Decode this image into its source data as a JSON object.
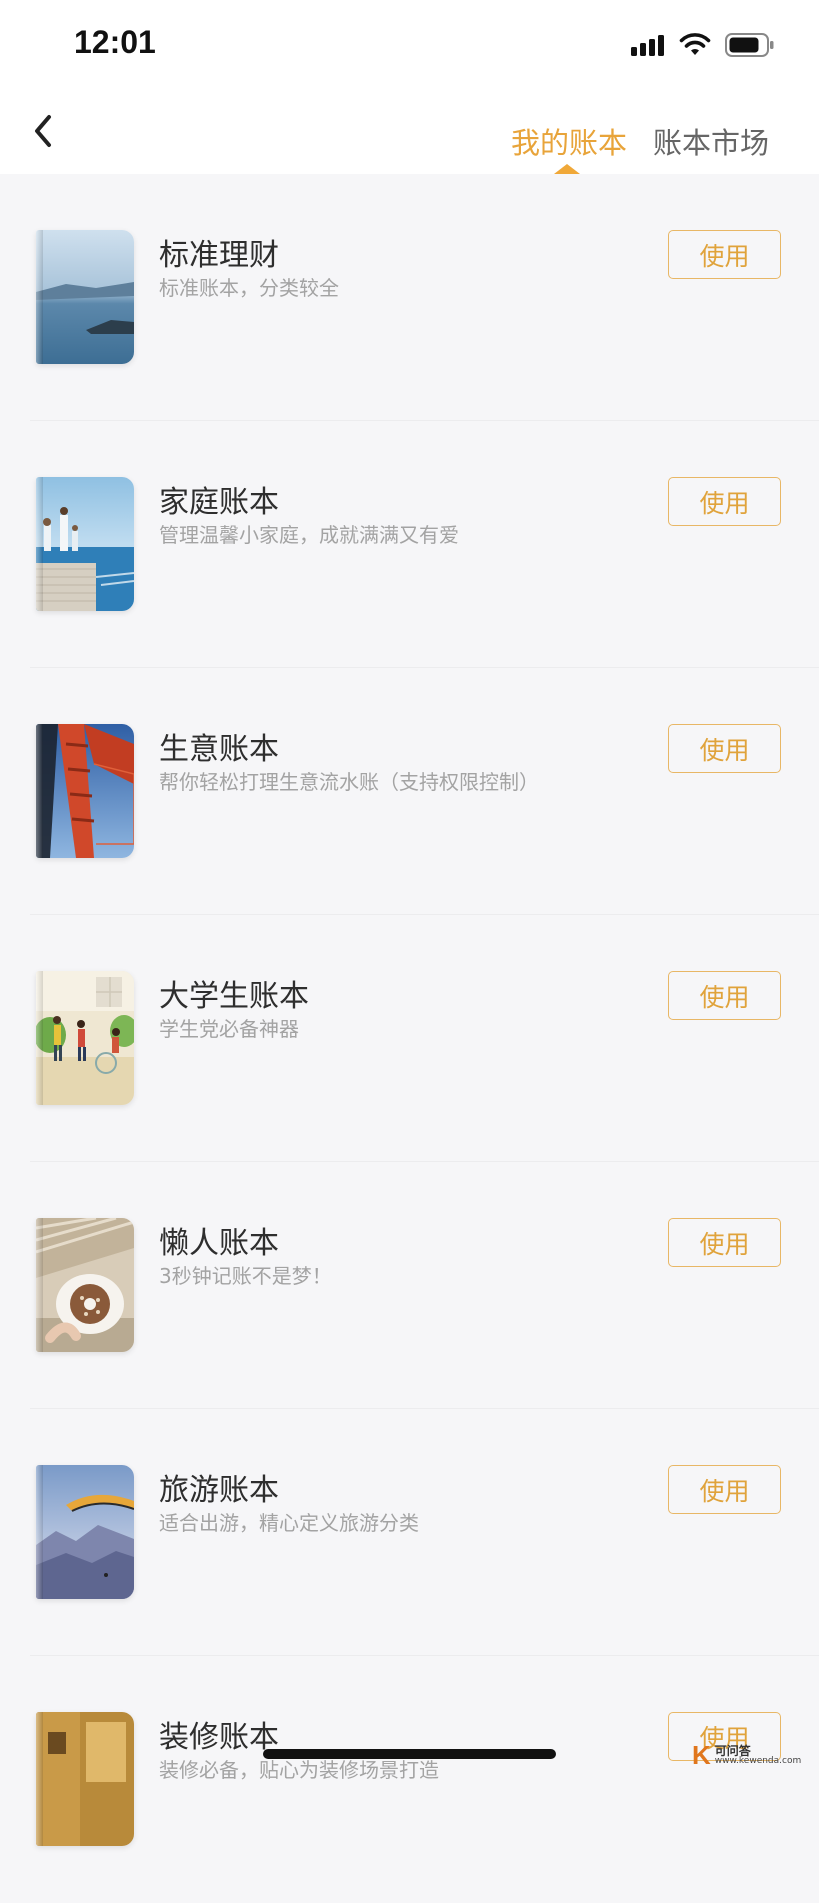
{
  "status_bar": {
    "time": "12:01",
    "icons": [
      "cellular-signal-icon",
      "wifi-icon",
      "battery-icon"
    ]
  },
  "nav": {
    "back_icon": "chevron-left-icon",
    "tabs": [
      {
        "label": "我的账本",
        "active": true
      },
      {
        "label": "账本市场",
        "active": false
      }
    ]
  },
  "books": [
    {
      "title": "标准理财",
      "desc": "标准账本，分类较全",
      "button": "使用",
      "cover": "lake-landscape"
    },
    {
      "title": "家庭账本",
      "desc": "管理温馨小家庭，成就满满又有爱",
      "button": "使用",
      "cover": "family-beach-pier"
    },
    {
      "title": "生意账本",
      "desc": "帮你轻松打理生意流水账（支持权限控制）",
      "button": "使用",
      "cover": "red-bridge"
    },
    {
      "title": "大学生账本",
      "desc": "学生党必备神器",
      "button": "使用",
      "cover": "students-illustration"
    },
    {
      "title": "懒人账本",
      "desc": "3秒钟记账不是梦！",
      "button": "使用",
      "cover": "donut-plate"
    },
    {
      "title": "旅游账本",
      "desc": "适合出游，精心定义旅游分类",
      "button": "使用",
      "cover": "paraglider-mountains"
    },
    {
      "title": "装修账本",
      "desc": "装修必备，贴心为装修场景打造",
      "button": "使用",
      "cover": "interior-room"
    }
  ],
  "watermark": {
    "logo": "K",
    "name": "可问答",
    "url": "www.kewenda.com"
  },
  "colors": {
    "accent": "#e8a43a",
    "background": "#f6f6f8",
    "title": "#2e2e2e",
    "desc": "#a3a3a3"
  }
}
